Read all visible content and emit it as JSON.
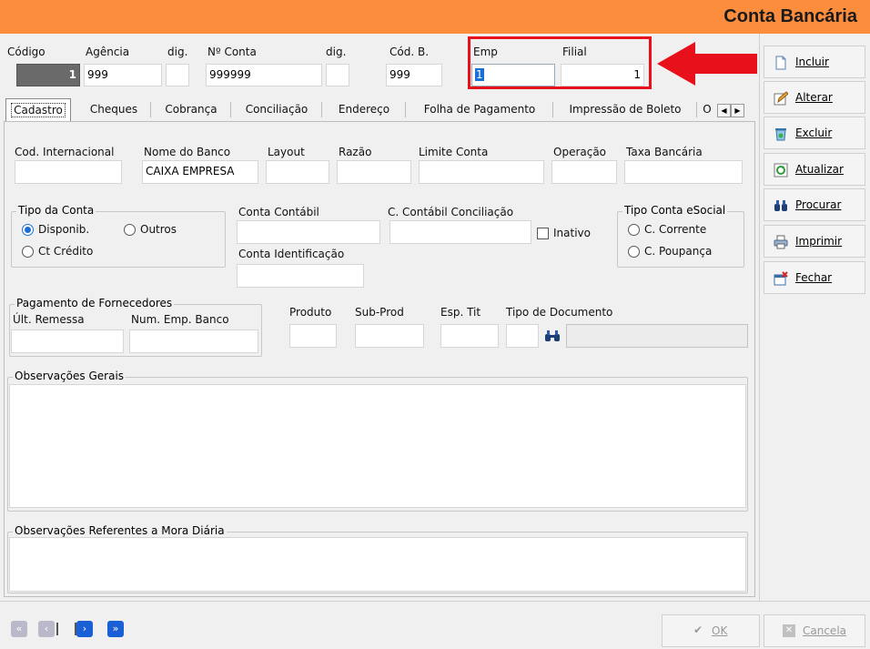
{
  "window": {
    "title": "Conta Bancária"
  },
  "header_fields": {
    "codigo": {
      "label": "Código",
      "value": "1"
    },
    "agencia": {
      "label": "Agência",
      "value": "999"
    },
    "agencia_dig": {
      "label": "dig.",
      "value": ""
    },
    "num_conta": {
      "label": "Nº Conta",
      "value": "999999"
    },
    "conta_dig": {
      "label": "dig.",
      "value": ""
    },
    "cod_b": {
      "label": "Cód. B.",
      "value": "999"
    },
    "emp": {
      "label": "Emp",
      "value": "1"
    },
    "filial": {
      "label": "Filial",
      "value": "1"
    }
  },
  "tabs": [
    {
      "label": "Cadastro"
    },
    {
      "label": "Cheques"
    },
    {
      "label": "Cobrança"
    },
    {
      "label": "Conciliação"
    },
    {
      "label": "Endereço"
    },
    {
      "label": "Folha de Pagamento"
    },
    {
      "label": "Impressão de Boleto"
    },
    {
      "label": "O"
    }
  ],
  "cadastro": {
    "cod_internacional": {
      "label": "Cod. Internacional",
      "value": ""
    },
    "nome_banco": {
      "label": "Nome do Banco",
      "value": "CAIXA EMPRESA"
    },
    "layout": {
      "label": "Layout",
      "value": ""
    },
    "razao": {
      "label": "Razão",
      "value": ""
    },
    "limite_conta": {
      "label": "Limite Conta",
      "value": ""
    },
    "operacao": {
      "label": "Operação",
      "value": ""
    },
    "taxa_bancaria": {
      "label": "Taxa Bancária",
      "value": ""
    },
    "tipo_conta": {
      "title": "Tipo da Conta",
      "opt1": "Disponib.",
      "opt2": "Outros",
      "opt3": "Ct Crédito",
      "selected": "Disponib."
    },
    "conta_contabil": {
      "label": "Conta Contábil",
      "value": ""
    },
    "c_contabil_conciliacao": {
      "label": "C. Contábil Conciliação",
      "value": ""
    },
    "inativo": {
      "label": "Inativo",
      "checked": false
    },
    "tipo_conta_esocial": {
      "title": "Tipo Conta eSocial",
      "opt1": "C. Corrente",
      "opt2": "C. Poupança"
    },
    "conta_identificacao": {
      "label": "Conta Identificação",
      "value": ""
    },
    "pagamento_fornecedores": {
      "title": "Pagamento de Fornecedores",
      "ult_remessa": "Últ. Remessa",
      "num_emp_banco": "Num. Emp. Banco"
    },
    "produto": {
      "label": "Produto",
      "value": ""
    },
    "sub_prod": {
      "label": "Sub-Prod",
      "value": ""
    },
    "esp_tit": {
      "label": "Esp. Tit",
      "value": ""
    },
    "tipo_documento": {
      "label": "Tipo de Documento",
      "value": ""
    },
    "observacoes_gerais": {
      "title": "Observações Gerais",
      "value": ""
    },
    "observacoes_mora": {
      "title": "Observações Referentes a Mora Diária",
      "value": ""
    }
  },
  "side_buttons": [
    {
      "label": "Incluir"
    },
    {
      "label": "Alterar"
    },
    {
      "label": "Excluir"
    },
    {
      "label": "Atualizar"
    },
    {
      "label": "Procurar"
    },
    {
      "label": "Imprimir"
    },
    {
      "label": "Fechar"
    }
  ],
  "bottom": {
    "ok_label": "OK",
    "cancel_label": "Cancela"
  },
  "colors": {
    "title_bar": "#fb8d3c",
    "highlight": "#e8101a",
    "accent": "#1a6fd6"
  }
}
